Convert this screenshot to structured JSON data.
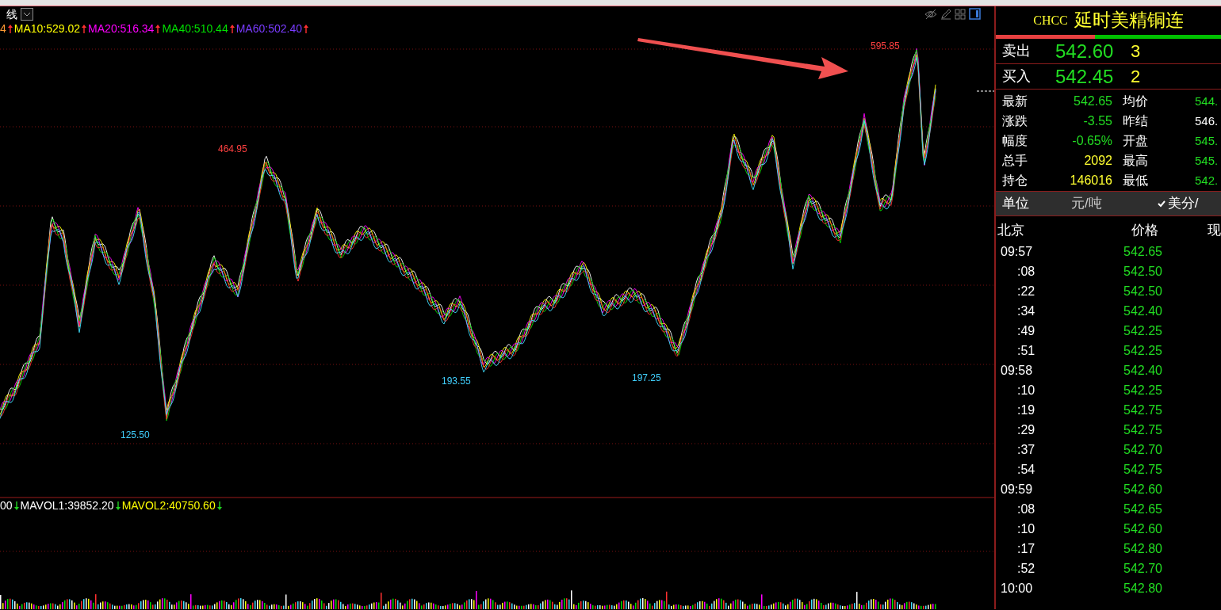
{
  "chart": {
    "title": "线",
    "ma_legend": [
      {
        "text": "4",
        "color": "#ff9933",
        "arrow": {
          "kind": "up",
          "color": "#ff3030"
        }
      },
      {
        "text": "MA10:529.02",
        "color": "#ffff00",
        "arrow": {
          "kind": "up",
          "color": "#ff3030"
        }
      },
      {
        "text": "MA20:516.34",
        "color": "#ff00ff",
        "arrow": {
          "kind": "up",
          "color": "#ff3030"
        }
      },
      {
        "text": "MA40:510.44",
        "color": "#00e000",
        "arrow": {
          "kind": "up",
          "color": "#ff3030"
        }
      },
      {
        "text": "MA60:502.40",
        "color": "#7a3cff",
        "arrow": {
          "kind": "up",
          "color": "#ff3030"
        }
      }
    ],
    "price_labels": [
      {
        "text": "464.95",
        "kind": "high"
      },
      {
        "text": "125.50",
        "kind": "low"
      },
      {
        "text": "193.55",
        "kind": "low"
      },
      {
        "text": "197.25",
        "kind": "low"
      },
      {
        "text": "595.85",
        "kind": "high"
      }
    ],
    "volume_legend": [
      {
        "text": "00",
        "color": "#ffffff",
        "arrow": {
          "kind": "down",
          "color": "#20d020"
        }
      },
      {
        "text": "MAVOL1:39852.20",
        "color": "#ffffff",
        "arrow": {
          "kind": "down",
          "color": "#20d020"
        }
      },
      {
        "text": "MAVOL2:40750.60",
        "color": "#ffff00",
        "arrow": {
          "kind": "down",
          "color": "#20d020"
        }
      }
    ]
  },
  "quote": {
    "code": "CHCC",
    "name": "延时美精铜连",
    "ratio_bar": {
      "level": 0.44
    },
    "bid_ask": [
      {
        "label": "卖出",
        "price": "542.60",
        "qty": "3"
      },
      {
        "label": "买入",
        "price": "542.45",
        "qty": "2"
      }
    ],
    "stats": [
      {
        "label": "最新",
        "value": {
          "text": "542.65",
          "color": "#22dd22"
        },
        "label2": "均价",
        "value2": {
          "text": "544.",
          "color": "#22dd22"
        }
      },
      {
        "label": "涨跌",
        "value": {
          "text": "-3.55",
          "color": "#22dd22"
        },
        "label2": "昨结",
        "value2": {
          "text": "546.",
          "color": "#ffffff"
        }
      },
      {
        "label": "幅度",
        "value": {
          "text": "-0.65%",
          "color": "#22dd22"
        },
        "label2": "开盘",
        "value2": {
          "text": "545.",
          "color": "#22dd22"
        }
      },
      {
        "label": "总手",
        "value": {
          "text": "2092",
          "color": "#ffff30"
        },
        "label2": "最高",
        "value2": {
          "text": "545.",
          "color": "#22dd22"
        }
      },
      {
        "label": "持仓",
        "value": {
          "text": "146016",
          "color": "#ffff30"
        },
        "label2": "最低",
        "value2": {
          "text": "542.",
          "color": "#22dd22"
        }
      }
    ],
    "unit": {
      "label": "单位",
      "options": [
        {
          "text": "元/吨",
          "selected": false
        },
        {
          "text": "美分/",
          "selected": true
        }
      ]
    },
    "ticks_header": {
      "time": "北京",
      "price": "价格",
      "column_3": "现"
    },
    "ticks": [
      {
        "time": "09:57",
        "kind": "minute",
        "price": "542.65"
      },
      {
        "time": ":08",
        "kind": "second",
        "price": "542.50"
      },
      {
        "time": ":22",
        "kind": "second",
        "price": "542.50"
      },
      {
        "time": ":34",
        "kind": "second",
        "price": "542.40"
      },
      {
        "time": ":49",
        "kind": "second",
        "price": "542.25"
      },
      {
        "time": ":51",
        "kind": "second",
        "price": "542.25"
      },
      {
        "time": "09:58",
        "kind": "minute",
        "price": "542.40"
      },
      {
        "time": ":10",
        "kind": "second",
        "price": "542.25"
      },
      {
        "time": ":19",
        "kind": "second",
        "price": "542.75"
      },
      {
        "time": ":29",
        "kind": "second",
        "price": "542.75"
      },
      {
        "time": ":37",
        "kind": "second",
        "price": "542.70"
      },
      {
        "time": ":54",
        "kind": "second",
        "price": "542.75"
      },
      {
        "time": "09:59",
        "kind": "minute",
        "price": "542.60"
      },
      {
        "time": ":08",
        "kind": "second",
        "price": "542.65"
      },
      {
        "time": ":10",
        "kind": "second",
        "price": "542.60"
      },
      {
        "time": ":17",
        "kind": "second",
        "price": "542.80"
      },
      {
        "time": ":52",
        "kind": "second",
        "price": "542.70"
      },
      {
        "time": "10:00",
        "kind": "minute",
        "price": "542.80"
      }
    ]
  }
}
